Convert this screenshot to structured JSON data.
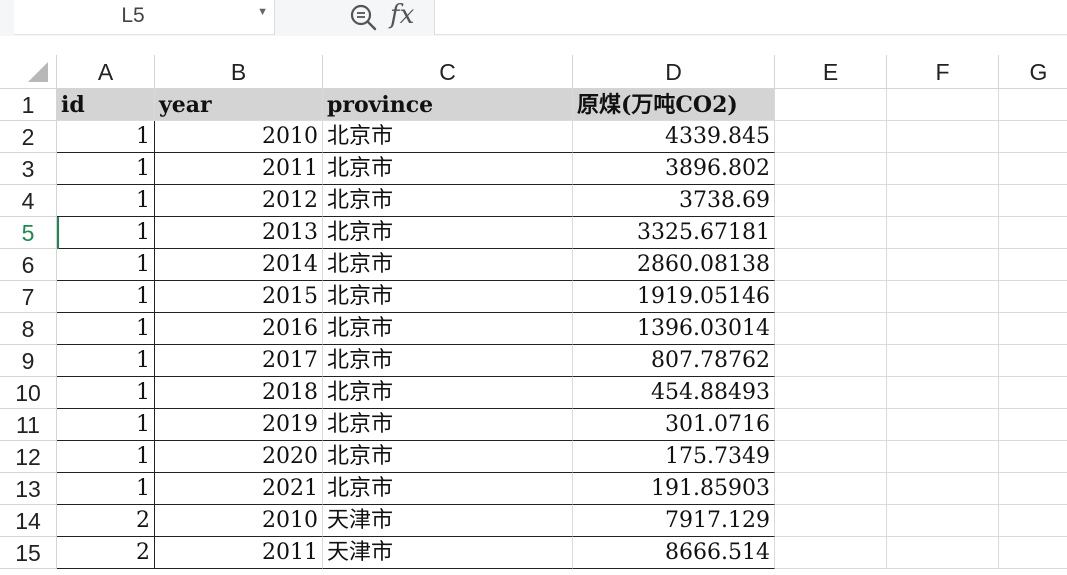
{
  "name_box": {
    "value": "L5"
  },
  "formula_bar": {
    "fx_label": "fx",
    "value": ""
  },
  "columns": [
    "A",
    "B",
    "C",
    "D",
    "E",
    "F",
    "G"
  ],
  "rows": [
    "1",
    "2",
    "3",
    "4",
    "5",
    "6",
    "7",
    "8",
    "9",
    "10",
    "11",
    "12",
    "13",
    "14",
    "15"
  ],
  "active_row": "5",
  "header": {
    "id": "id",
    "year": "year",
    "province": "province",
    "coal": "原煤(万吨CO2)"
  },
  "data": [
    {
      "id": "1",
      "year": "2010",
      "province": "北京市",
      "coal": "4339.845"
    },
    {
      "id": "1",
      "year": "2011",
      "province": "北京市",
      "coal": "3896.802"
    },
    {
      "id": "1",
      "year": "2012",
      "province": "北京市",
      "coal": "3738.69"
    },
    {
      "id": "1",
      "year": "2013",
      "province": "北京市",
      "coal": "3325.67181"
    },
    {
      "id": "1",
      "year": "2014",
      "province": "北京市",
      "coal": "2860.08138"
    },
    {
      "id": "1",
      "year": "2015",
      "province": "北京市",
      "coal": "1919.05146"
    },
    {
      "id": "1",
      "year": "2016",
      "province": "北京市",
      "coal": "1396.03014"
    },
    {
      "id": "1",
      "year": "2017",
      "province": "北京市",
      "coal": "807.78762"
    },
    {
      "id": "1",
      "year": "2018",
      "province": "北京市",
      "coal": "454.88493"
    },
    {
      "id": "1",
      "year": "2019",
      "province": "北京市",
      "coal": "301.0716"
    },
    {
      "id": "1",
      "year": "2020",
      "province": "北京市",
      "coal": "175.7349"
    },
    {
      "id": "1",
      "year": "2021",
      "province": "北京市",
      "coal": "191.85903"
    },
    {
      "id": "2",
      "year": "2010",
      "province": "天津市",
      "coal": "7917.129"
    },
    {
      "id": "2",
      "year": "2011",
      "province": "天津市",
      "coal": "8666.514"
    }
  ],
  "icons": {
    "zoom": "zoom-formula-icon",
    "dropdown": "chevron-down-icon",
    "select_all": "select-all-triangle-icon"
  }
}
